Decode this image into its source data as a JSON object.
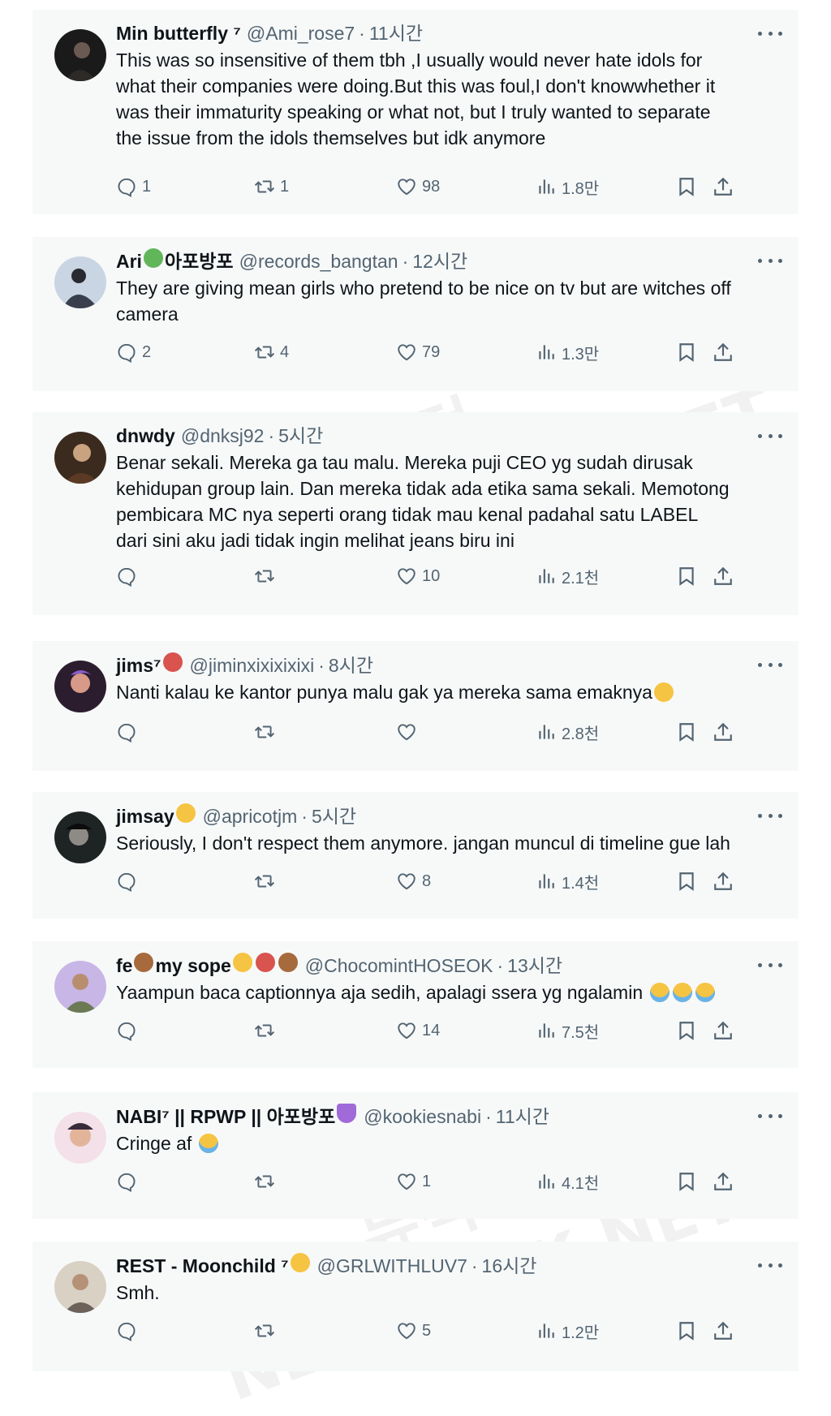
{
  "tweets": [
    {
      "name": "Min butterfly ⁷",
      "handle": "@Ami_rose7",
      "time": "11시간",
      "text": "This was so insensitive of them tbh ,I usually would never hate idols for\nwhat their companies were doing.But this was foul,I don't knowwhether it\nwas their immaturity speaking or what not, but I truly wanted to separate\nthe issue from the idols themselves but idk anymore",
      "replies": "1",
      "retweets": "1",
      "likes": "98",
      "views": "1.8만"
    },
    {
      "name": "Ari",
      "name_suffix": "아포방포",
      "handle": "@records_bangtan",
      "time": "12시간",
      "text": "They are giving mean girls who pretend to be nice on tv but are witches off\ncamera",
      "replies": "2",
      "retweets": "4",
      "likes": "79",
      "views": "1.3만"
    },
    {
      "name": "dnwdy",
      "handle": "@dnksj92",
      "time": "5시간",
      "text": "Benar sekali. Mereka ga tau malu. Mereka puji CEO yg sudah dirusak\nkehidupan group lain. Dan mereka tidak ada etika sama sekali. Memotong\npembicara MC nya seperti orang tidak mau kenal padahal satu LABEL\ndari sini aku jadi tidak ingin melihat jeans biru ini",
      "replies": "",
      "retweets": "",
      "likes": "10",
      "views": "2.1천"
    },
    {
      "name": "jims⁷",
      "handle": "@jiminxixixixixi",
      "time": "8시간",
      "text": "Nanti kalau ke kantor punya malu gak ya mereka sama emaknya",
      "replies": "",
      "retweets": "",
      "likes": "",
      "views": "2.8천"
    },
    {
      "name": "jimsay",
      "handle": "@apricotjm",
      "time": "5시간",
      "text": "Seriously, I don't respect them anymore. jangan muncul di timeline gue lah",
      "replies": "",
      "retweets": "",
      "likes": "8",
      "views": "1.4천"
    },
    {
      "name": "fe",
      "name_suffix": "my sope",
      "handle": "@ChocomintHOSEOK",
      "time": "13시간",
      "text": "Yaampun baca captionnya aja sedih, apalagi ssera yg ngalamin",
      "replies": "",
      "retweets": "",
      "likes": "14",
      "views": "7.5천"
    },
    {
      "name": "NABI⁷ || RPWP || 아포방포",
      "handle": "@kookiesnabi",
      "time": "11시간",
      "text": "Cringe af",
      "replies": "",
      "retweets": "",
      "likes": "1",
      "views": "4.1천"
    },
    {
      "name": "REST - Moonchild ⁷",
      "handle": "@GRLWITHLUV7",
      "time": "16시간",
      "text": "Smh.",
      "replies": "",
      "retweets": "",
      "likes": "5",
      "views": "1.2만"
    }
  ],
  "watermark": "NEWDUCK.NET",
  "watermark_kr": "뉴덕",
  "colors": {
    "card_bg": "#f7f9f9",
    "secondary_text": "#536471",
    "primary_text": "#0f1419"
  }
}
